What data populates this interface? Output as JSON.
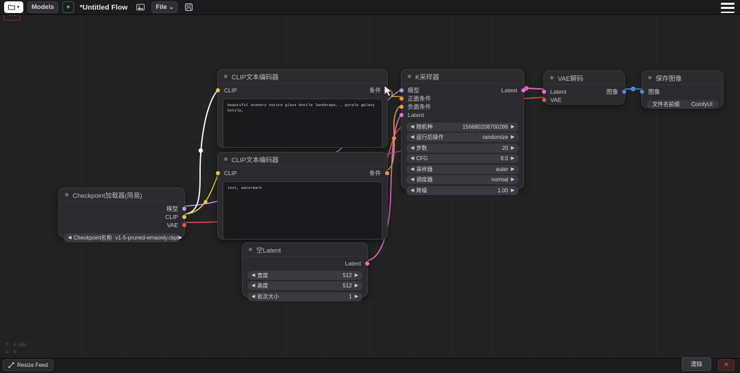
{
  "topbar": {
    "folder_icon": "folder-icon",
    "folder_caret": "▾",
    "models_label": "Models",
    "add_label": "+",
    "flow_title": "*Untitled Flow",
    "image_icon": "image-icon",
    "file_label": "File",
    "file_caret": "⌄",
    "save_icon": "floppy-disk-icon",
    "menu_icon": "hamburger-menu-icon",
    "red_tab_label": "none"
  },
  "nodes": {
    "clip_positive": {
      "title": "CLIP文本编码器",
      "input_label": "CLIP",
      "output_label": "条件",
      "text": "beautiful scenery nature glass bottle landscape, , purple galaxy bottle,"
    },
    "clip_negative": {
      "title": "CLIP文本编码器",
      "input_label": "CLIP",
      "output_label": "条件",
      "text": "text, watermark"
    },
    "ksampler": {
      "title": "K采样器",
      "inputs": [
        "模型",
        "正面条件",
        "负面条件",
        "Latent"
      ],
      "output_label": "Latent",
      "widgets": [
        {
          "name": "随机种",
          "value": "156680208700286"
        },
        {
          "name": "运行后操作",
          "value": "randomize"
        },
        {
          "name": "步数",
          "value": "20"
        },
        {
          "name": "CFG",
          "value": "8.0"
        },
        {
          "name": "采样器",
          "value": "euler"
        },
        {
          "name": "调度器",
          "value": "normal"
        },
        {
          "name": "降噪",
          "value": "1.00"
        }
      ]
    },
    "vae_decode": {
      "title": "VAE解码",
      "inputs": [
        "Latent",
        "VAE"
      ],
      "output_label": "图像"
    },
    "save_image": {
      "title": "保存图像",
      "input_label": "图像",
      "widget": {
        "name": "文件名前缀",
        "value": "ComfyUI"
      }
    },
    "checkpoint_loader": {
      "title": "Checkpoint加载器(简易)",
      "outputs": [
        "模型",
        "CLIP",
        "VAE"
      ],
      "widget": {
        "name": "Checkpoint名称",
        "value": "v1-5-pruned-emaonly.ckpt"
      }
    },
    "empty_latent": {
      "title": "空Latent",
      "output_label": "Latent",
      "widgets": [
        {
          "name": "宽度",
          "value": "512"
        },
        {
          "name": "高度",
          "value": "512"
        },
        {
          "name": "批次大小",
          "value": "1"
        }
      ]
    }
  },
  "stats": {
    "line1": "T: 0.00s",
    "line2": "I: 0"
  },
  "bottombar": {
    "resize_feed_label": "Resize Feed",
    "resize_icon": "resize-icon",
    "clear_label": "清除",
    "close_label": "✕"
  },
  "colors": {
    "canvas_bg": "#222222",
    "node_bg": "#2b2b2f",
    "clip_slot": "#e0c64a",
    "cond_slot": "#e89a3c",
    "model_slot": "#a6a0e8",
    "latent_slot": "#ef6ed0",
    "vae_slot": "#e5534b",
    "image_slot": "#4b8ce0",
    "highlight_link": "#ffffff"
  }
}
